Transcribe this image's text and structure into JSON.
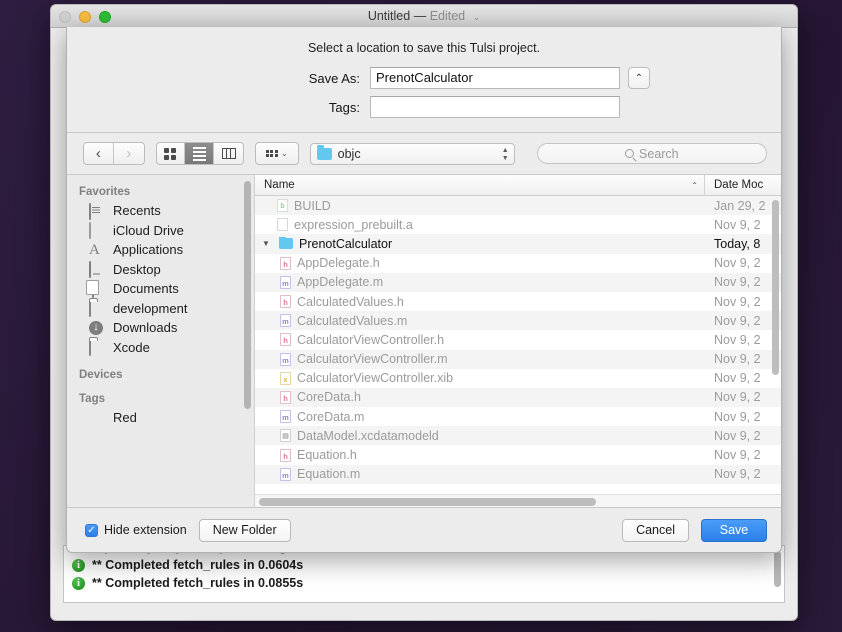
{
  "window": {
    "title": "Untitled",
    "title_separator": "—",
    "title_status": "Edited",
    "title_chevron": "⌄"
  },
  "sheet": {
    "prompt": "Select a location to save this Tulsi project.",
    "save_as_label": "Save As:",
    "save_as_value": "PrenotCalculator",
    "tags_label": "Tags:",
    "tags_value": "",
    "disclose_icon": "⌃"
  },
  "toolbar": {
    "back_icon": "‹",
    "forward_icon": "›",
    "view_icon_icon": "grid-view",
    "view_list_icon": "list-view",
    "view_column_icon": "column-view",
    "arrange_icon": "arrange",
    "arrange_chevron": "⌄",
    "path_folder": "objc",
    "search_placeholder": "Search"
  },
  "sidebar": {
    "favorites_header": "Favorites",
    "favorites": [
      {
        "label": "Recents",
        "icon": "recents-icon"
      },
      {
        "label": "iCloud Drive",
        "icon": "cloud-icon"
      },
      {
        "label": "Applications",
        "icon": "applications-icon"
      },
      {
        "label": "Desktop",
        "icon": "desktop-icon"
      },
      {
        "label": "Documents",
        "icon": "documents-icon"
      },
      {
        "label": "development",
        "icon": "folder-icon"
      },
      {
        "label": "Downloads",
        "icon": "downloads-icon"
      },
      {
        "label": "Xcode",
        "icon": "folder-icon"
      }
    ],
    "devices_header": "Devices",
    "tags_header": "Tags",
    "tags": [
      {
        "label": "Red",
        "color": "#f4605c"
      }
    ]
  },
  "filelist": {
    "col_name": "Name",
    "col_date": "Date Moc",
    "sort_caret": "⌃",
    "rows": [
      {
        "name": "BUILD",
        "date": "Jan 29, 2",
        "icon": "build",
        "glyph": "b",
        "indent": 1,
        "twisty": "",
        "current": false
      },
      {
        "name": "expression_prebuilt.a",
        "date": "Nov 9, 2",
        "icon": "plain",
        "glyph": "",
        "indent": 1,
        "twisty": "",
        "current": false
      },
      {
        "name": "PrenotCalculator",
        "date": "Today, 8",
        "icon": "folder",
        "glyph": "",
        "indent": 0,
        "twisty": "▼",
        "current": true
      },
      {
        "name": "AppDelegate.h",
        "date": "Nov 9, 2",
        "icon": "h",
        "glyph": "h",
        "indent": 2,
        "twisty": "",
        "current": false
      },
      {
        "name": "AppDelegate.m",
        "date": "Nov 9, 2",
        "icon": "m",
        "glyph": "m",
        "indent": 2,
        "twisty": "",
        "current": false
      },
      {
        "name": "CalculatedValues.h",
        "date": "Nov 9, 2",
        "icon": "h",
        "glyph": "h",
        "indent": 2,
        "twisty": "",
        "current": false
      },
      {
        "name": "CalculatedValues.m",
        "date": "Nov 9, 2",
        "icon": "m",
        "glyph": "m",
        "indent": 2,
        "twisty": "",
        "current": false
      },
      {
        "name": "CalculatorViewController.h",
        "date": "Nov 9, 2",
        "icon": "h",
        "glyph": "h",
        "indent": 2,
        "twisty": "",
        "current": false
      },
      {
        "name": "CalculatorViewController.m",
        "date": "Nov 9, 2",
        "icon": "m",
        "glyph": "m",
        "indent": 2,
        "twisty": "",
        "current": false
      },
      {
        "name": "CalculatorViewController.xib",
        "date": "Nov 9, 2",
        "icon": "xib",
        "glyph": "x",
        "indent": 2,
        "twisty": "",
        "current": false
      },
      {
        "name": "CoreData.h",
        "date": "Nov 9, 2",
        "icon": "h",
        "glyph": "h",
        "indent": 2,
        "twisty": "",
        "current": false
      },
      {
        "name": "CoreData.m",
        "date": "Nov 9, 2",
        "icon": "m",
        "glyph": "m",
        "indent": 2,
        "twisty": "",
        "current": false
      },
      {
        "name": "DataModel.xcdatamodeld",
        "date": "Nov 9, 2",
        "icon": "data",
        "glyph": "▤",
        "indent": 2,
        "twisty": "",
        "current": false
      },
      {
        "name": "Equation.h",
        "date": "Nov 9, 2",
        "icon": "h",
        "glyph": "h",
        "indent": 2,
        "twisty": "",
        "current": false
      },
      {
        "name": "Equation.m",
        "date": "Nov 9, 2",
        "icon": "m",
        "glyph": "m",
        "indent": 2,
        "twisty": "",
        "current": false
      }
    ]
  },
  "footer": {
    "hide_extension_label": "Hide extension",
    "checkbox_glyph": "✓",
    "new_folder_label": "New Folder",
    "cancel_label": "Cancel",
    "save_label": "Save"
  },
  "log": {
    "partial_line": "examples/objc:all) ; --output ; 'xml' ]",
    "lines": [
      {
        "icon": "i",
        "text": "** Completed fetch_rules in 0.0604s"
      },
      {
        "icon": "i",
        "text": "** Completed fetch_rules in 0.0855s"
      }
    ]
  }
}
